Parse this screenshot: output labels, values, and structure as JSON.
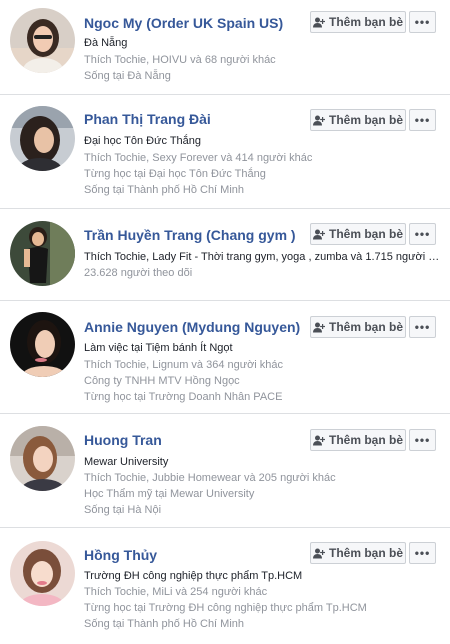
{
  "buttons": {
    "add_friend": "Thêm bạn bè",
    "more": "•••"
  },
  "people": [
    {
      "name": "Ngoc My (Order UK Spain US)",
      "primary": "Đà Nẵng",
      "secondary": [
        "Thích Tochie, HOIVU và 68 người khác",
        "Sống tại Đà Nẵng"
      ]
    },
    {
      "name": "Phan Thị Trang Đài",
      "primary": "Đại học Tôn Đức Thắng",
      "secondary": [
        "Thích Tochie, Sexy Forever và 414 người khác",
        "Từng học tại Đại học Tôn Đức Thắng",
        "Sống tại Thành phố Hồ Chí Minh"
      ]
    },
    {
      "name": "Trần Huyền Trang (Chang gym )",
      "primary": "Thích Tochie, Lady Fit - Thời trang gym, yoga , zumba và 1.715 người k...",
      "secondary": [
        "23.628 người theo dõi"
      ]
    },
    {
      "name": "Annie Nguyen (Mydung Nguyen)",
      "primary": "Làm việc tại Tiệm bánh Ít Ngọt",
      "secondary": [
        "Thích Tochie, Lignum và 364 người khác",
        "Công ty TNHH MTV Hồng Ngọc",
        "Từng học tại Trường Doanh Nhân PACE"
      ]
    },
    {
      "name": "Huong Tran",
      "primary": "Mewar University",
      "secondary": [
        "Thích Tochie, Jubbie Homewear và 205 người khác",
        "Học Thẩm mỹ tại Mewar University",
        "Sống tại Hà Nội"
      ]
    },
    {
      "name": "Hồng Thủy",
      "primary": "Trường ĐH công nghiệp thực phẩm Tp.HCM",
      "secondary": [
        "Thích Tochie, MiLi và 254 người khác",
        "Từng học tại Trường ĐH công nghiệp thực phẩm Tp.HCM",
        "Sống tại Thành phố Hồ Chí Minh"
      ]
    }
  ]
}
